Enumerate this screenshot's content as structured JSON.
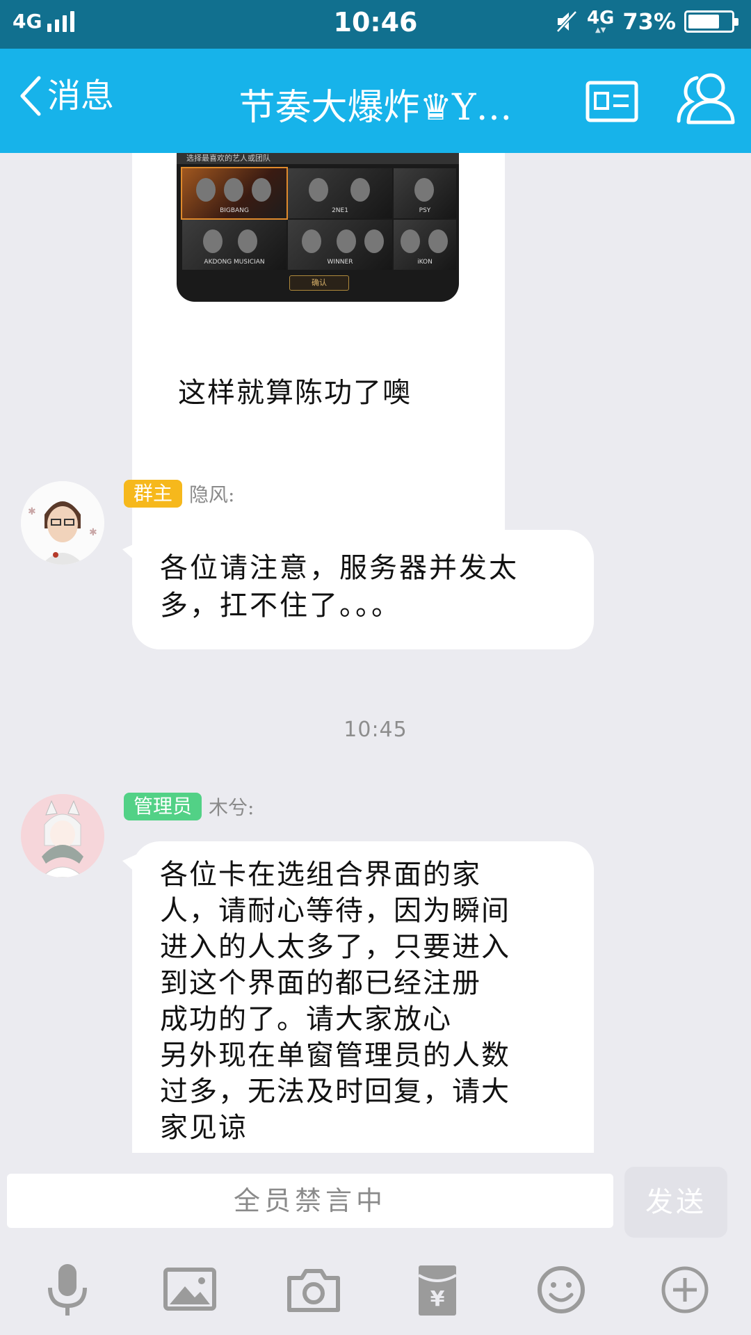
{
  "status_bar": {
    "network": "4G",
    "time": "10:46",
    "network_2": "4G",
    "battery_percent": "73%",
    "battery_level": 0.73
  },
  "nav": {
    "back_label": "消息",
    "title": "节奏大爆炸♛Y…"
  },
  "image_message": {
    "header": "选择最喜欢的艺人或团队",
    "tiles": [
      "BIGBANG",
      "2NE1",
      "PSY",
      "AKDONG MUSICIAN",
      "WINNER",
      "iKON"
    ],
    "confirm": "确认",
    "caption": "这样就算陈功了噢"
  },
  "messages": [
    {
      "role_badge": "群主",
      "sender": "隐风:",
      "lines": [
        "各位请注意，服务器并发太",
        "多，扛不住了。。。"
      ]
    },
    {
      "role_badge": "管理员",
      "sender": "木兮:",
      "lines": [
        "各位卡在选组合界面的家",
        "人，请耐心等待，因为瞬间",
        "进入的人太多了，只要进入",
        "到这个界面的都已经注册",
        "成功的了。请大家放心",
        "另外现在单窗管理员的人数",
        "过多，无法及时回复，请大",
        "家见谅"
      ]
    }
  ],
  "timestamp": "10:45",
  "input": {
    "muted_text": "全员禁言中",
    "send_label": "发送"
  },
  "toolbar_icons": [
    "microphone-icon",
    "image-icon",
    "camera-icon",
    "red-packet-icon",
    "emoji-icon",
    "plus-icon"
  ],
  "colors": {
    "status_bar": "#11708f",
    "nav_bar": "#17b3ea",
    "owner_badge": "#f6b81c",
    "admin_badge": "#52d186",
    "background": "#ebebf0"
  }
}
